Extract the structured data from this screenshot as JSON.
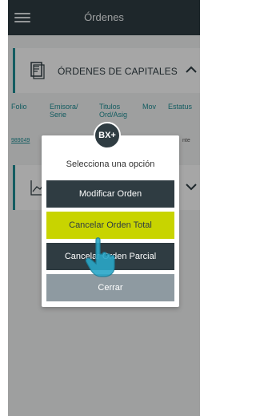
{
  "header": {
    "title": "Órdenes",
    "menu_icon": "hamburger-icon"
  },
  "section1": {
    "label": "ÓRDENES DE CAPITALES",
    "icon": "document-icon",
    "toggle_icon": "chevron-up-icon"
  },
  "section2": {
    "icon": "line-chart-icon",
    "toggle_icon": "chevron-down-icon"
  },
  "table": {
    "columns": [
      "Folio",
      "Emisora/ Serie",
      "Titulos Ord/Asig",
      "Mov",
      "Estatus"
    ],
    "row1": {
      "folio": "989049",
      "status_fragment": "nte"
    }
  },
  "modal": {
    "badge": "BX+",
    "prompt": "Selecciona una opción",
    "buttons": [
      "Modificar Orden",
      "Cancelar Orden Total",
      "Cancelar Orden Parcial",
      "Cerrar"
    ]
  },
  "colors": {
    "dark": "#2f3c42",
    "accent": "#1e8e95",
    "highlight": "#c8d400",
    "close": "#8e9aa1"
  }
}
